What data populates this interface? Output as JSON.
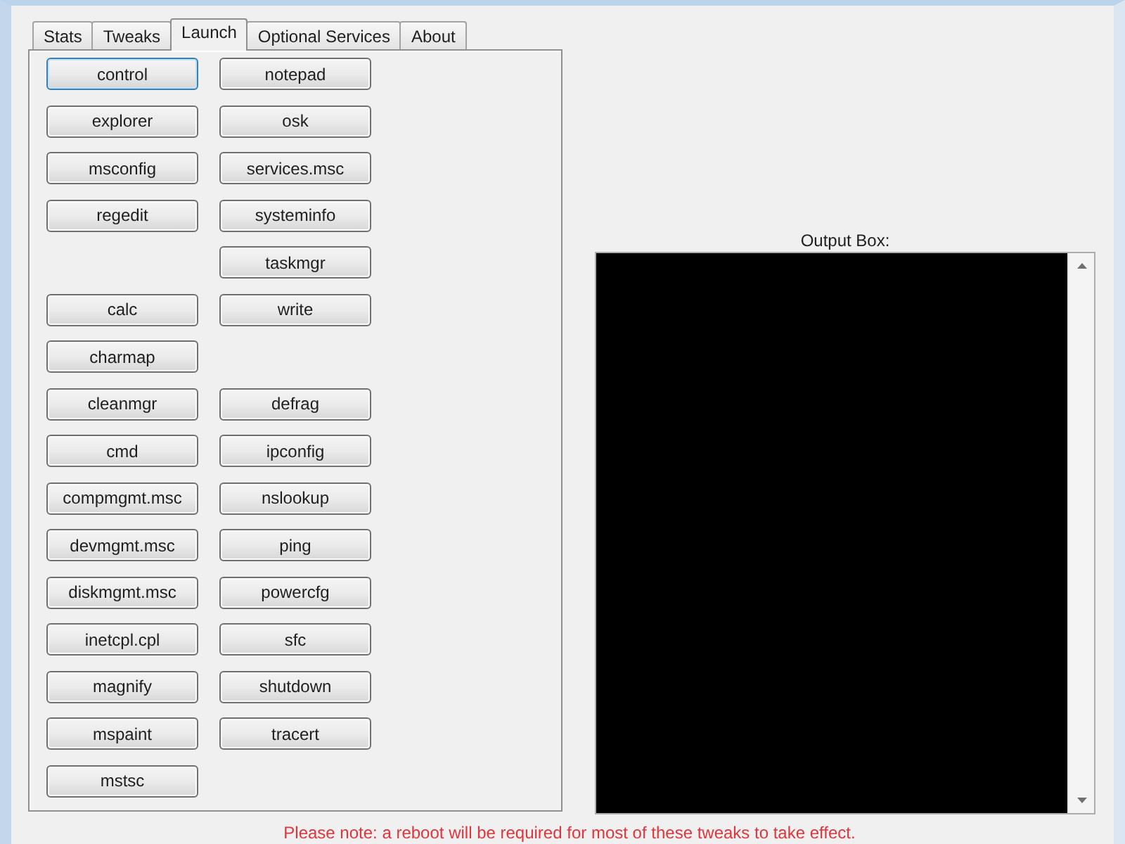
{
  "tabs": [
    {
      "label": "Stats",
      "selected": false
    },
    {
      "label": "Tweaks",
      "selected": false
    },
    {
      "label": "Launch",
      "selected": true
    },
    {
      "label": "Optional Services",
      "selected": false
    },
    {
      "label": "About",
      "selected": false
    }
  ],
  "launch_rows": [
    {
      "left": {
        "label": "control",
        "focused": true
      },
      "right": {
        "label": "notepad",
        "focused": false
      }
    },
    {
      "left": {
        "label": "explorer",
        "focused": false
      },
      "right": {
        "label": "osk",
        "focused": false
      }
    },
    {
      "left": {
        "label": "msconfig",
        "focused": false
      },
      "right": {
        "label": "services.msc",
        "focused": false
      }
    },
    {
      "left": {
        "label": "regedit",
        "focused": false
      },
      "right": {
        "label": "systeminfo",
        "focused": false
      }
    },
    {
      "right": {
        "label": "taskmgr",
        "focused": false
      }
    },
    {
      "left": {
        "label": "calc",
        "focused": false
      },
      "right": {
        "label": "write",
        "focused": false
      }
    },
    {
      "left": {
        "label": "charmap",
        "focused": false
      }
    },
    {
      "left": {
        "label": "cleanmgr",
        "focused": false
      },
      "right": {
        "label": "defrag",
        "focused": false
      }
    },
    {
      "left": {
        "label": "cmd",
        "focused": false
      },
      "right": {
        "label": "ipconfig",
        "focused": false
      }
    },
    {
      "left": {
        "label": "compmgmt.msc",
        "focused": false
      },
      "right": {
        "label": "nslookup",
        "focused": false
      }
    },
    {
      "left": {
        "label": "devmgmt.msc",
        "focused": false
      },
      "right": {
        "label": "ping",
        "focused": false
      }
    },
    {
      "left": {
        "label": "diskmgmt.msc",
        "focused": false
      },
      "right": {
        "label": "powercfg",
        "focused": false
      }
    },
    {
      "left": {
        "label": "inetcpl.cpl",
        "focused": false
      },
      "right": {
        "label": "sfc",
        "focused": false
      }
    },
    {
      "left": {
        "label": "magnify",
        "focused": false
      },
      "right": {
        "label": "shutdown",
        "focused": false
      }
    },
    {
      "left": {
        "label": "mspaint",
        "focused": false
      },
      "right": {
        "label": "tracert",
        "focused": false
      }
    },
    {
      "left": {
        "label": "mstsc",
        "focused": false
      }
    }
  ],
  "output": {
    "label": "Output Box:"
  },
  "notice": "Please note: a reboot will be required for most of these tweaks to take effect."
}
